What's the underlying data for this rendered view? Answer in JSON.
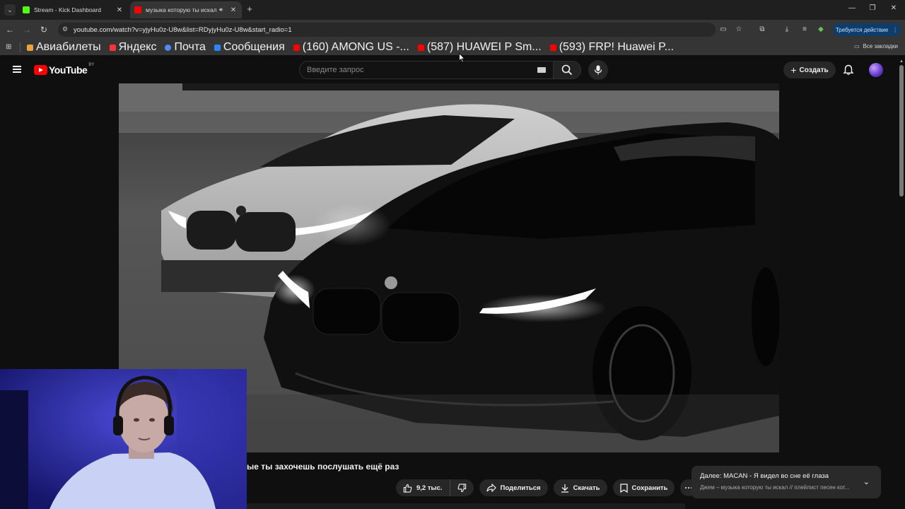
{
  "browser": {
    "tabs": [
      {
        "title": "Stream - Kick Dashboard",
        "favicon_color": "#53fc18",
        "active": false
      },
      {
        "title": "музыка которую ты искал",
        "favicon_color": "#ff0000",
        "active": true
      }
    ],
    "url": "youtube.com/watch?v=yjyHu0z-U8w&list=RDyjyHu0z-U8w&start_radio=1",
    "action_pill": "Требуется действие",
    "bookmarks": [
      {
        "label": "Авиабилеты",
        "color": "#e8a33c"
      },
      {
        "label": "Яндекс",
        "color": "#ff3333"
      },
      {
        "label": "Почта",
        "color": "#4a8cff"
      },
      {
        "label": "Сообщения",
        "color": "#2787f5"
      },
      {
        "label": "(160) AMONG US -...",
        "color": "#ff0000"
      },
      {
        "label": "(587) HUAWEI P Sm...",
        "color": "#ff0000"
      },
      {
        "label": "(593) FRP! Huawei P...",
        "color": "#ff0000"
      }
    ],
    "all_bookmarks": "Все закладки"
  },
  "youtube": {
    "logo_text": "YouTube",
    "country_code": "BY",
    "search_placeholder": "Введите запрос",
    "create_label": "Создать",
    "video_title": "ые ты захочешь послушать ещё раз",
    "likes": "9,2 тыс.",
    "share_label": "Поделиться",
    "download_label": "Скачать",
    "save_label": "Сохранить",
    "up_next_title": "Далее: MACAN - Я видел во сне её глаза",
    "up_next_playlist": "Джем – музыка которую ты искал // плейлист песен кот..."
  },
  "colors": {
    "background": "#0f0f0f",
    "chip": "#272727",
    "brand_red": "#ff0000",
    "action_pill": "#0e3d6b"
  }
}
